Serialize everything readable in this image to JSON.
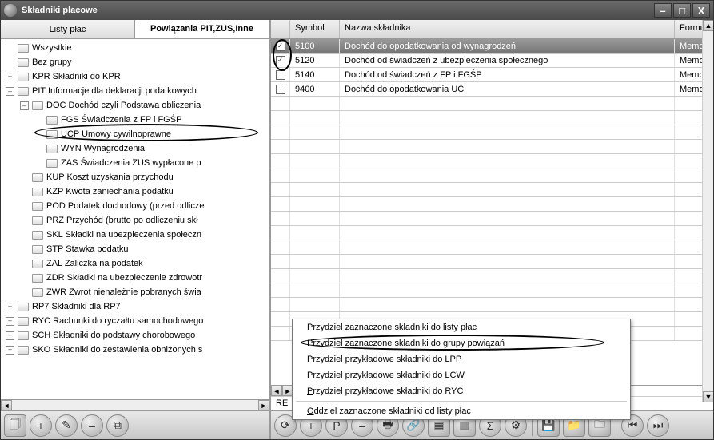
{
  "title": "Składniki płacowe",
  "tabs": {
    "left": "Listy płac",
    "right": "Powiązania PIT,ZUS,Inne"
  },
  "tree": {
    "n0": "Wszystkie",
    "n1": "Bez grupy",
    "n2": "KPR Składniki do KPR",
    "n3": "PIT Informacje dla deklaracji podatkowych",
    "n3_0": "DOC Dochód czyli Podstawa obliczenia",
    "n3_0_0": "FGS Świadczenia z FP i FGŚP",
    "n3_0_1": "UCP Umowy cywilnoprawne",
    "n3_0_2": "WYN Wynagrodzenia",
    "n3_0_3": "ZAS Świadczenia ZUS wypłacone p",
    "n3_1": "KUP Koszt uzyskania przychodu",
    "n3_2": "KZP Kwota zaniechania podatku",
    "n3_3": "POD Podatek dochodowy (przed odlicze",
    "n3_4": "PRZ Przychód (brutto po odliczeniu skł",
    "n3_5": "SKL Składki na ubezpieczenia społeczn",
    "n3_6": "STP Stawka podatku",
    "n3_7": "ZAL Zaliczka na podatek",
    "n3_8": "ZDR Składki na ubezpieczenie zdrowotr",
    "n3_9": "ZWR Zwrot nienależnie pobranych świa",
    "n4": "RP7 Składniki dla RP7",
    "n5": "RYC Rachunki do ryczałtu samochodowego",
    "n6": "SCH Składniki do podstawy chorobowego",
    "n7": "SKO Składniki do zestawienia obniżonych s"
  },
  "grid": {
    "headers": {
      "symbol": "Symbol",
      "name": "Nazwa składnika",
      "formula": "Formuł"
    },
    "rows": [
      {
        "checked": true,
        "symbol": "5100",
        "name": "Dochód do opodatkowania od wynagrodzeń",
        "formula": "Memo",
        "selected": true
      },
      {
        "checked": true,
        "symbol": "5120",
        "name": "Dochód od świadczeń z ubezpieczenia społecznego",
        "formula": "Memo",
        "selected": false
      },
      {
        "checked": false,
        "symbol": "5140",
        "name": "Dochód od świadczeń z FP i FGŚP",
        "formula": "Memo",
        "selected": false
      },
      {
        "checked": false,
        "symbol": "9400",
        "name": "Dochód do opodatkowania  UC",
        "formula": "Memo",
        "selected": false
      }
    ]
  },
  "menu": {
    "m0a": "P",
    "m0b": "rzydziel zaznaczone składniki do listy płac",
    "m1a": "P",
    "m1b": "rzydziel zaznaczone składniki do grupy powiązań",
    "m2a": "P",
    "m2b": "rzydziel przykładowe składniki do LPP",
    "m3a": "P",
    "m3b": "rzydziel przykładowe składniki do LCW",
    "m4a": "P",
    "m4b": "rzydziel przykładowe składniki do RYC",
    "m5a": "O",
    "m5b": "ddziel zaznaczone składniki od listy płac"
  },
  "re": "RE"
}
